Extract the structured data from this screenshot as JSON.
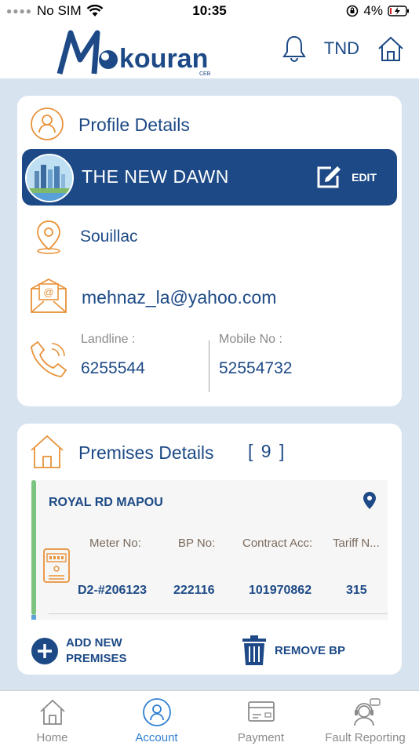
{
  "status": {
    "carrier": "No SIM",
    "time": "10:35",
    "battery": "4%"
  },
  "header": {
    "logo_text": "kouran",
    "logo_subtext": "CEB",
    "currency": "TND"
  },
  "profile": {
    "title": "Profile Details",
    "name": "THE NEW DAWN",
    "edit_label": "EDIT",
    "location": "Souillac",
    "email": "mehnaz_la@yahoo.com",
    "landline_label": "Landline :",
    "landline": "6255544",
    "mobile_label": "Mobile No :",
    "mobile": "52554732"
  },
  "premises": {
    "title": "Premises Details",
    "count": "[ 9 ]",
    "item": {
      "address": "ROYAL RD MAPOU",
      "meter_label": "Meter No:",
      "meter": "D2-#206123",
      "bp_label": "BP No:",
      "bp": "222116",
      "contract_label": "Contract Acc:",
      "contract": "101970862",
      "tariff_label": "Tariff N...",
      "tariff": "315"
    },
    "add_label_1": "ADD NEW",
    "add_label_2": "PREMISES",
    "remove_label": "REMOVE BP"
  },
  "tabs": [
    {
      "label": "Home",
      "icon": "home-icon"
    },
    {
      "label": "Account",
      "icon": "user-icon"
    },
    {
      "label": "Payment",
      "icon": "card-icon"
    },
    {
      "label": "Fault Reporting",
      "icon": "support-icon"
    }
  ],
  "colors": {
    "primary": "#1d4a86",
    "accent_orange": "#e8923a",
    "background": "#d7e3ef",
    "active_tab": "#2f7fd1"
  }
}
